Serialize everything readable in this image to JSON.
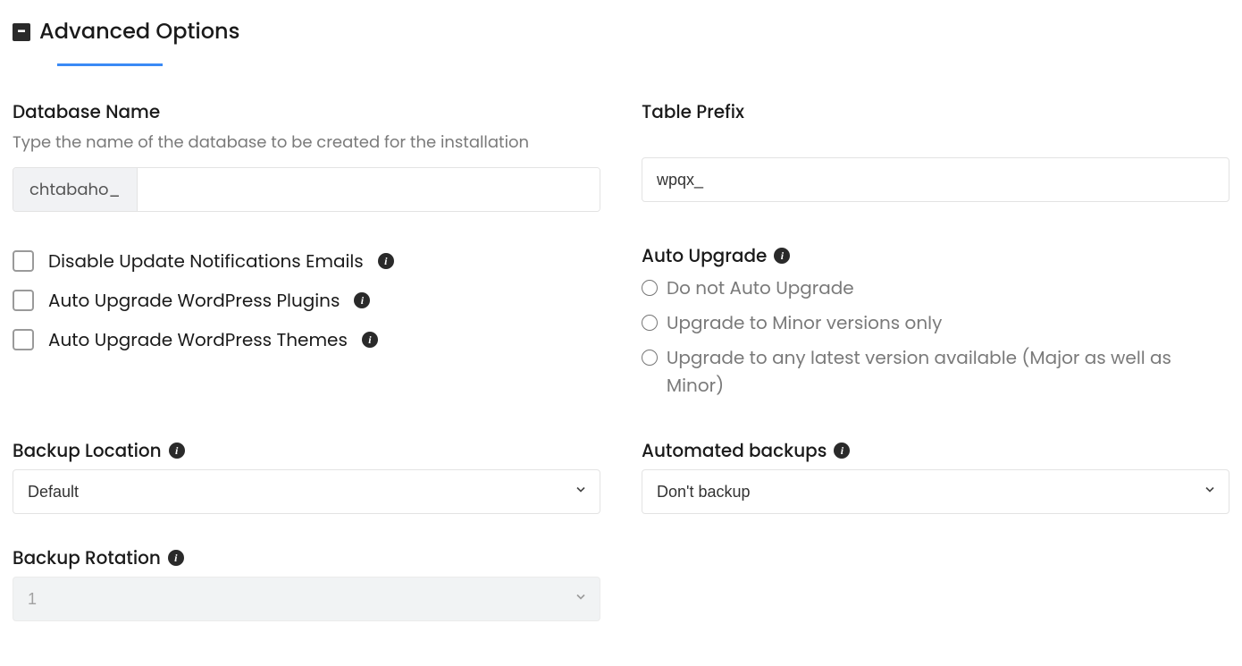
{
  "header": {
    "title": "Advanced Options"
  },
  "db": {
    "label": "Database Name",
    "help": "Type the name of the database to be created for the installation",
    "prefix": "chtabaho_",
    "value": ""
  },
  "tablePrefix": {
    "label": "Table Prefix",
    "value": "wpqx_"
  },
  "checkboxes": {
    "disableEmails": "Disable Update Notifications Emails",
    "upgradePlugins": "Auto Upgrade WordPress Plugins",
    "upgradeThemes": "Auto Upgrade WordPress Themes"
  },
  "autoUpgrade": {
    "label": "Auto Upgrade",
    "opt1": "Do not Auto Upgrade",
    "opt2": "Upgrade to Minor versions only",
    "opt3": "Upgrade to any latest version available (Major as well as Minor)"
  },
  "backupLocation": {
    "label": "Backup Location",
    "value": "Default"
  },
  "automatedBackups": {
    "label": "Automated backups",
    "value": "Don't backup"
  },
  "backupRotation": {
    "label": "Backup Rotation",
    "value": "1"
  }
}
